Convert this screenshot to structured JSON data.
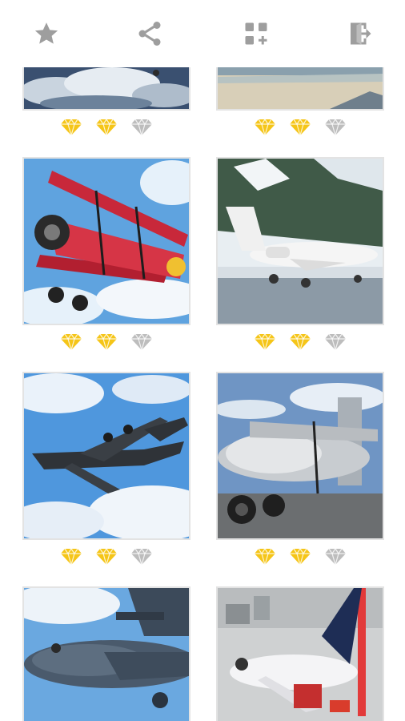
{
  "toolbar": {
    "buttons": [
      {
        "name": "favorite-button",
        "icon": "star-icon"
      },
      {
        "name": "share-button",
        "icon": "share-icon"
      },
      {
        "name": "add-app-button",
        "icon": "apps-add-icon"
      },
      {
        "name": "exit-button",
        "icon": "exit-icon"
      }
    ],
    "icon_color": "#9e9e9e"
  },
  "puzzles": [
    {
      "id": "row0-left",
      "subject": "clouds",
      "diamonds": [
        true,
        true,
        false
      ]
    },
    {
      "id": "row0-right",
      "subject": "landscape",
      "diamonds": [
        true,
        true,
        false
      ]
    },
    {
      "id": "row1-left",
      "subject": "red-biplane",
      "diamonds": [
        true,
        true,
        false
      ]
    },
    {
      "id": "row1-right",
      "subject": "business-jet-snow",
      "diamonds": [
        true,
        true,
        false
      ]
    },
    {
      "id": "row2-left",
      "subject": "military-transport-a400m",
      "diamonds": [
        true,
        true,
        false
      ]
    },
    {
      "id": "row2-right",
      "subject": "b17-bomber",
      "diamonds": [
        true,
        true,
        false
      ]
    },
    {
      "id": "row3-left",
      "subject": "transport-plane-closeup",
      "diamonds": [
        null,
        null,
        null
      ]
    },
    {
      "id": "row3-right",
      "subject": "airliner-model-airport",
      "diamonds": [
        null,
        null,
        null
      ]
    }
  ],
  "colors": {
    "diamond_earned": "#f5c518",
    "diamond_empty": "#bdbdbd",
    "tile_border": "#e3e3e3"
  }
}
